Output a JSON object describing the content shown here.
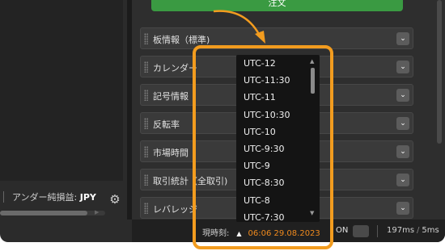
{
  "order_button": {
    "label": "注文"
  },
  "left_status": {
    "label": "アンダー純損益:",
    "currency": "JPY"
  },
  "panels": [
    {
      "label": "板情報（標準)"
    },
    {
      "label": "カレンダー"
    },
    {
      "label": "記号情報"
    },
    {
      "label": "反転率"
    },
    {
      "label": "市場時間"
    },
    {
      "label": "取引統計（全取引)"
    },
    {
      "label": "レバレッジ"
    }
  ],
  "timezone_dropdown": {
    "options": [
      "UTC-12",
      "UTC-11:30",
      "UTC-11",
      "UTC-10:30",
      "UTC-10",
      "UTC-9:30",
      "UTC-9",
      "UTC-8:30",
      "UTC-8",
      "UTC-7:30"
    ]
  },
  "status_bar": {
    "time_label": "現時刻:",
    "time_value": "06:06 29.08.2023",
    "connection_label": "ON",
    "ping_1": "197ms",
    "ping_2": "5ms"
  },
  "colors": {
    "accent": "#f29c1f",
    "order_green": "#3a9a42",
    "time_orange": "#f08a1d"
  },
  "icons": {
    "settings": "gear-icon",
    "expand": "chevron-down-icon"
  }
}
